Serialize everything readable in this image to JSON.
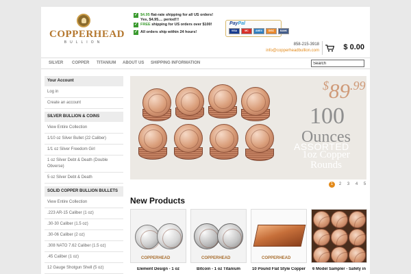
{
  "header": {
    "logo_main": "COPPERHEAD",
    "logo_sub": "BULLION",
    "promo": {
      "line1_price": "$4.95",
      "line1_rest": "flat-rate shipping for all US orders!",
      "line2": "Yes, $4.95.... period!!!",
      "line3_free": "FREE",
      "line3_rest": "shipping for US orders over $100!",
      "line4": "All orders ship within 24 hours!"
    },
    "paypal_pay": "Pay",
    "paypal_pal": "Pal",
    "paypal_cards": [
      "VISA",
      "MC",
      "AMEX",
      "DISC",
      "BANK"
    ],
    "phone": "858-215-3918",
    "email": "info@copperheadbullion.com",
    "cart_total": "$ 0.00"
  },
  "nav": {
    "items": [
      "SILVER",
      "COPPER",
      "TITANIUM",
      "ABOUT US",
      "SHIPPING INFORMATION"
    ],
    "search_value": "Search"
  },
  "sidebar": {
    "account_head": "Your Account",
    "account_items": [
      "Log in",
      "Create an account"
    ],
    "silver_head": "SILVER BULLION & COINS",
    "silver_items": [
      "View Entire Collection",
      "1/10 oz Silver Bullet (22 Caliber)",
      "1/1 oz Silver Freedom Girl",
      "1 oz Silver Debt & Death (Double Obverse)",
      "5 oz Silver Debt & Death"
    ],
    "copper_head": "SOLID COPPER BULLION BULLETS",
    "copper_items": [
      "View Entire Collection",
      ".223 AR-15 Caliber (1 oz)",
      ".30-30 Caliber (1.5 oz)",
      ".30-06 Caliber (2 oz)",
      ".308 NATO 7.62 Caliber (1.5 oz)",
      ".45 Caliber (1 oz)",
      "12 Gauge Shotgun Shell (5 oz)"
    ]
  },
  "slider": {
    "price_dollar": "$",
    "price_main": "89",
    "price_cents": ".99",
    "line1": "100",
    "line2": "Ounces",
    "line3": "ASSORTED",
    "line4": "1oz Copper",
    "line5": "Rounds",
    "pages": [
      "1",
      "2",
      "3",
      "4",
      "5",
      "6"
    ]
  },
  "new_products": {
    "title": "New Products",
    "watermark": "COPPERHEAD",
    "items": [
      {
        "name": "Element Design - 1 oz"
      },
      {
        "name": "Bitcoin - 1 oz Titanium"
      },
      {
        "name": "10 Pound Flat Style Copper"
      },
      {
        "name": "6 Model Sampler - Safety in"
      }
    ]
  },
  "colors": {
    "accent_orange": "#e38a1a",
    "promo_green": "#3a9a2e",
    "copper": "#b4772e"
  }
}
